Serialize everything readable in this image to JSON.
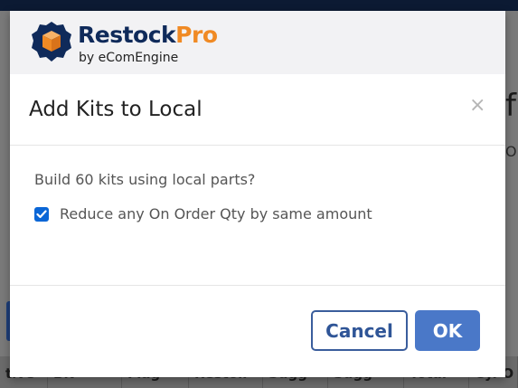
{
  "background": {
    "table_headers": [
      "tive",
      "BN",
      "Flag",
      "Restoll",
      "Sugg",
      "Sugg",
      "Total",
      "Cy. O"
    ]
  },
  "brand": {
    "name_main": "Restock",
    "name_accent": "Pro",
    "tagline": "by eComEngine",
    "colors": {
      "navy": "#0f2a5a",
      "orange": "#f08a24"
    }
  },
  "modal": {
    "title": "Add Kits to Local",
    "close_icon": "×",
    "question": "Build 60 kits using local parts?",
    "option": {
      "label": "Reduce any On Order Qty by same amount",
      "checked": true
    },
    "buttons": {
      "cancel": "Cancel",
      "ok": "OK"
    }
  },
  "colors": {
    "primary": "#4a78c8",
    "checkbox": "#0a66d6"
  }
}
